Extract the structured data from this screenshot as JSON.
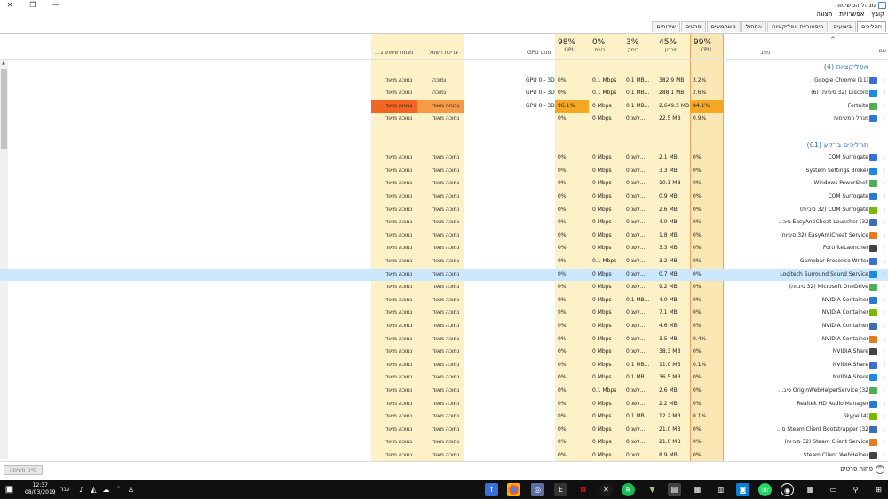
{
  "window": {
    "title": "מנהל המשימות",
    "minimize_glyph": "—",
    "restore_glyph": "❐",
    "close_glyph": "✕"
  },
  "menu": [
    "קובץ",
    "אפשרויות",
    "תצוגה"
  ],
  "tabs": [
    "תהליכים",
    "ביצועים",
    "היסטוריית אפליקציות",
    "אתחול",
    "משתמשים",
    "פרטים",
    "שירותים"
  ],
  "headers": {
    "name": "שם",
    "status": "מצב",
    "cpu_pct": "99%",
    "cpu": "CPU",
    "memory_pct": "45%",
    "memory": "זיכרון",
    "disk_pct": "3%",
    "disk": "דיסק",
    "network_pct": "0%",
    "network": "רשת",
    "gpu_pct": "98%",
    "gpu": "GPU",
    "gpu_engine": "מנוע GPU",
    "power_usage": "צריכת חשמל",
    "power_trend": "מגמת שימוש ב..."
  },
  "groups": {
    "apps": "אפליקציות (4)",
    "background": "תהליכים ברקע (61)"
  },
  "apps": [
    {
      "name": "Google Chrome (11)",
      "cpu": "3.2%",
      "memory": "382.9 MB",
      "disk": "0.1 MB...",
      "network": "0.1 Mbps",
      "gpu": "0%",
      "engine": "GPU 0 - 3D",
      "power": "נמוכה",
      "trend": "נמוכה מאוד"
    },
    {
      "name": "Discord (32 סיביות) (6)",
      "cpu": "2.6%",
      "memory": "288.1 MB",
      "disk": "0.1 MB...",
      "network": "0.1 Mbps",
      "gpu": "0%",
      "engine": "GPU 0 - 3D",
      "power": "נמוכה",
      "trend": "נמוכה מאוד"
    },
    {
      "name": "Fortnite",
      "cpu": "84.1%",
      "memory": "2,649.5 MB",
      "disk": "0.1 MB...",
      "network": "0 Mbps",
      "gpu": "96.1%",
      "engine": "GPU 0 - 3D",
      "power": "גבוהה מאוד",
      "trend": "גבוהה מאוד"
    },
    {
      "name": "מנהל המשימות",
      "cpu": "0.9%",
      "memory": "22.5 MB",
      "disk": "0 לשנ...",
      "network": "0 Mbps",
      "gpu": "0%",
      "engine": "",
      "power": "נמוכה מאוד",
      "trend": "נמוכה מאוד"
    }
  ],
  "background": [
    {
      "name": "COM Surrogate",
      "cpu": "0%",
      "memory": "2.1 MB",
      "disk": "0 לשנ...",
      "network": "0 Mbps",
      "gpu": "0%",
      "power": "נמוכה מאוד",
      "trend": "נמוכה מאוד"
    },
    {
      "name": "System Settings Broker",
      "cpu": "0%",
      "memory": "3.3 MB",
      "disk": "0 לשנ...",
      "network": "0 Mbps",
      "gpu": "0%",
      "power": "נמוכה מאוד",
      "trend": "נמוכה מאוד"
    },
    {
      "name": "Windows PowerShell",
      "cpu": "0%",
      "memory": "10.1 MB",
      "disk": "0 לשנ...",
      "network": "0 Mbps",
      "gpu": "0%",
      "power": "נמוכה מאוד",
      "trend": "נמוכה מאוד"
    },
    {
      "name": "COM Surrogate",
      "cpu": "0%",
      "memory": "0.9 MB",
      "disk": "0 לשנ...",
      "network": "0 Mbps",
      "gpu": "0%",
      "power": "נמוכה מאוד",
      "trend": "נמוכה מאוד"
    },
    {
      "name": "COM Surrogate (32 סיביות)",
      "cpu": "0%",
      "memory": "2.6 MB",
      "disk": "0 לשנ...",
      "network": "0 Mbps",
      "gpu": "0%",
      "power": "נמוכה מאוד",
      "trend": "נמוכה מאוד"
    },
    {
      "name": "EasyAntiCheat Launcher (32 סיב...",
      "cpu": "0%",
      "memory": "4.0 MB",
      "disk": "0 לשנ...",
      "network": "0 Mbps",
      "gpu": "0%",
      "power": "נמוכה מאוד",
      "trend": "נמוכה מאוד"
    },
    {
      "name": "EasyAntiCheat Service (32 סיביות)",
      "cpu": "0%",
      "memory": "1.8 MB",
      "disk": "0 לשנ...",
      "network": "0 Mbps",
      "gpu": "0%",
      "power": "נמוכה מאוד",
      "trend": "נמוכה מאוד"
    },
    {
      "name": "FortniteLauncher",
      "cpu": "0%",
      "memory": "3.3 MB",
      "disk": "0 לשנ...",
      "network": "0 Mbps",
      "gpu": "0%",
      "power": "נמוכה מאוד",
      "trend": "נמוכה מאוד"
    },
    {
      "name": "Gamebar Presence Writer",
      "cpu": "0%",
      "memory": "3.2 MB",
      "disk": "0 לשנ...",
      "network": "0.1 Mbps",
      "gpu": "0%",
      "power": "נמוכה מאוד",
      "trend": "נמוכה מאוד"
    },
    {
      "name": "Logitech Surround Sound Service",
      "cpu": "0%",
      "memory": "0.7 MB",
      "disk": "0 לשנ...",
      "network": "0 Mbps",
      "gpu": "0%",
      "power": "נמוכה מאוד",
      "trend": "נמוכה מאוד"
    },
    {
      "name": "Microsoft OneDrive (32 סיביות)",
      "cpu": "0%",
      "memory": "9.2 MB",
      "disk": "0 לשנ...",
      "network": "0 Mbps",
      "gpu": "0%",
      "power": "נמוכה מאוד",
      "trend": "נמוכה מאוד"
    },
    {
      "name": "NVIDIA Container",
      "cpu": "0%",
      "memory": "4.0 MB",
      "disk": "0.1 MB...",
      "network": "0 Mbps",
      "gpu": "0%",
      "power": "נמוכה מאוד",
      "trend": "נמוכה מאוד"
    },
    {
      "name": "NVIDIA Container",
      "cpu": "0%",
      "memory": "7.1 MB",
      "disk": "0 לשנ...",
      "network": "0 Mbps",
      "gpu": "0%",
      "power": "נמוכה מאוד",
      "trend": "נמוכה מאוד"
    },
    {
      "name": "NVIDIA Container",
      "cpu": "0%",
      "memory": "4.6 MB",
      "disk": "0 לשנ...",
      "network": "0 Mbps",
      "gpu": "0%",
      "power": "נמוכה מאוד",
      "trend": "נמוכה מאוד"
    },
    {
      "name": "NVIDIA Container",
      "cpu": "0.4%",
      "memory": "3.5 MB",
      "disk": "0 לשנ...",
      "network": "0 Mbps",
      "gpu": "0%",
      "power": "נמוכה מאוד",
      "trend": "נמוכה מאוד"
    },
    {
      "name": "NVIDIA Share",
      "cpu": "0%",
      "memory": "38.3 MB",
      "disk": "0 לשנ...",
      "network": "0 Mbps",
      "gpu": "0%",
      "power": "נמוכה מאוד",
      "trend": "נמוכה מאוד"
    },
    {
      "name": "NVIDIA Share",
      "cpu": "0.1%",
      "memory": "11.0 MB",
      "disk": "0.1 MB...",
      "network": "0 Mbps",
      "gpu": "0%",
      "power": "נמוכה מאוד",
      "trend": "נמוכה מאוד"
    },
    {
      "name": "NVIDIA Share",
      "cpu": "0%",
      "memory": "36.5 MB",
      "disk": "0.1 MB...",
      "network": "0 Mbps",
      "gpu": "0%",
      "power": "נמוכה מאוד",
      "trend": "נמוכה מאוד"
    },
    {
      "name": "OriginWebHelperService (32 סיב...",
      "cpu": "0%",
      "memory": "2.6 MB",
      "disk": "0 לשנ...",
      "network": "0.1 Mbps",
      "gpu": "0%",
      "power": "נמוכה מאוד",
      "trend": "נמוכה מאוד"
    },
    {
      "name": "Realtek HD Audio Manager",
      "cpu": "0%",
      "memory": "2.2 MB",
      "disk": "0 לשנ...",
      "network": "0 Mbps",
      "gpu": "0%",
      "power": "נמוכה מאוד",
      "trend": "נמוכה מאוד"
    },
    {
      "name": "Skype (4)",
      "cpu": "0.1%",
      "memory": "12.2 MB",
      "disk": "0.1 MB...",
      "network": "0 Mbps",
      "gpu": "0%",
      "power": "נמוכה מאוד",
      "trend": "נמוכה מאוד"
    },
    {
      "name": "Steam Client Bootstrapper (32 ס...",
      "cpu": "0%",
      "memory": "21.0 MB",
      "disk": "0 לשנ...",
      "network": "0 Mbps",
      "gpu": "0%",
      "power": "נמוכה מאוד",
      "trend": "נמוכה מאוד"
    },
    {
      "name": "Steam Client Service (32 סיביות)",
      "cpu": "0%",
      "memory": "21.0 MB",
      "disk": "0 לשנ...",
      "network": "0 Mbps",
      "gpu": "0%",
      "power": "נמוכה מאוד",
      "trend": "נמוכה מאוד"
    },
    {
      "name": "Steam Client WebHelper",
      "cpu": "0%",
      "memory": "8.9 MB",
      "disk": "0 לשנ...",
      "network": "0 Mbps",
      "gpu": "0%",
      "power": "נמוכה מאוד",
      "trend": "נמוכה מאוד"
    }
  ],
  "footer": {
    "end_task": "סיים משימה",
    "fewer_details": "פחות פרטים"
  },
  "taskbar": {
    "time": "12:37",
    "date": "08/03/2019",
    "lang": "עבר"
  },
  "colors": {
    "cell_bg": "#fdf2c7",
    "cpu_high": "#f5a623",
    "power_very_high": "#f26522",
    "accent": "#2f6fc7"
  }
}
